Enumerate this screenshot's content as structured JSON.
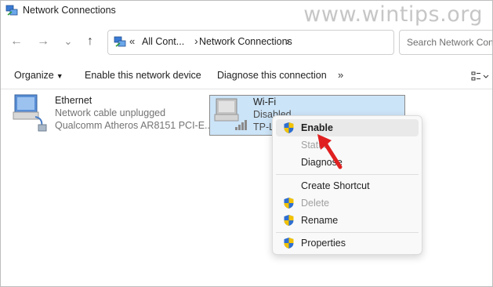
{
  "window": {
    "title": "Network Connections"
  },
  "watermark": "www.wintips.org",
  "nav": {
    "back_glyph": "←",
    "forward_glyph": "→",
    "recent_glyph": "⌄",
    "up_glyph": "↑"
  },
  "address": {
    "chevrons": "«",
    "segments": [
      "All Cont...",
      "Network Connections"
    ],
    "separator": "›"
  },
  "search": {
    "placeholder": "Search Network Conn"
  },
  "commandbar": {
    "organize": "Organize",
    "enable": "Enable this network device",
    "diagnose": "Diagnose this connection",
    "more": "»"
  },
  "connections": [
    {
      "name": "Ethernet",
      "status": "Network cable unplugged",
      "adapter": "Qualcomm Atheros AR8151 PCI-E..."
    },
    {
      "name": "Wi-Fi",
      "status": "Disabled",
      "adapter": "TP-L"
    }
  ],
  "context_menu": {
    "items": [
      {
        "label": "Enable",
        "bold": true,
        "disabled": false,
        "shield": true
      },
      {
        "label": "Status",
        "bold": false,
        "disabled": true,
        "shield": false
      },
      {
        "label": "Diagnose",
        "bold": false,
        "disabled": false,
        "shield": false
      },
      {
        "label": "Create Shortcut",
        "bold": false,
        "disabled": false,
        "shield": false
      },
      {
        "label": "Delete",
        "bold": false,
        "disabled": true,
        "shield": true
      },
      {
        "label": "Rename",
        "bold": false,
        "disabled": false,
        "shield": true
      },
      {
        "label": "Properties",
        "bold": false,
        "disabled": false,
        "shield": true
      }
    ]
  },
  "colors": {
    "selection": "#cce4f7",
    "arrow": "#e02020",
    "shield_blue": "#2f6fd0",
    "shield_yellow": "#f2c200"
  }
}
